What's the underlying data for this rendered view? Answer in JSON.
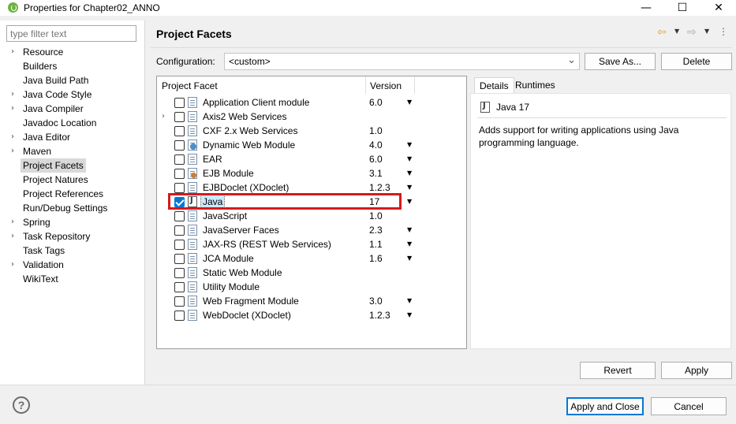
{
  "window": {
    "title": "Properties for Chapter02_ANNO",
    "minimize": "—",
    "maximize": "☐",
    "close": "✕"
  },
  "filter": {
    "placeholder": "type filter text"
  },
  "nav": {
    "items": [
      {
        "label": "Resource",
        "expandable": true
      },
      {
        "label": "Builders",
        "expandable": false
      },
      {
        "label": "Java Build Path",
        "expandable": false
      },
      {
        "label": "Java Code Style",
        "expandable": true
      },
      {
        "label": "Java Compiler",
        "expandable": true
      },
      {
        "label": "Javadoc Location",
        "expandable": false
      },
      {
        "label": "Java Editor",
        "expandable": true
      },
      {
        "label": "Maven",
        "expandable": true
      },
      {
        "label": "Project Facets",
        "expandable": false,
        "selected": true
      },
      {
        "label": "Project Natures",
        "expandable": false
      },
      {
        "label": "Project References",
        "expandable": false
      },
      {
        "label": "Run/Debug Settings",
        "expandable": false
      },
      {
        "label": "Spring",
        "expandable": true
      },
      {
        "label": "Task Repository",
        "expandable": true
      },
      {
        "label": "Task Tags",
        "expandable": false
      },
      {
        "label": "Validation",
        "expandable": true
      },
      {
        "label": "WikiText",
        "expandable": false
      }
    ]
  },
  "page": {
    "title": "Project Facets"
  },
  "config": {
    "label": "Configuration:",
    "value": "<custom>",
    "save_as": "Save As...",
    "delete": "Delete"
  },
  "facets": {
    "col_facet": "Project Facet",
    "col_version": "Version",
    "rows": [
      {
        "name": "Application Client module",
        "version": "6.0",
        "dropdown": true,
        "checked": false,
        "icon": "doc",
        "expandable": false
      },
      {
        "name": "Axis2 Web Services",
        "version": "",
        "dropdown": false,
        "checked": false,
        "icon": "doc",
        "expandable": true
      },
      {
        "name": "CXF 2.x Web Services",
        "version": "1.0",
        "dropdown": false,
        "checked": false,
        "icon": "doc",
        "expandable": false
      },
      {
        "name": "Dynamic Web Module",
        "version": "4.0",
        "dropdown": true,
        "checked": false,
        "icon": "globe",
        "expandable": false
      },
      {
        "name": "EAR",
        "version": "6.0",
        "dropdown": true,
        "checked": false,
        "icon": "doc",
        "expandable": false
      },
      {
        "name": "EJB Module",
        "version": "3.1",
        "dropdown": true,
        "checked": false,
        "icon": "gear",
        "expandable": false
      },
      {
        "name": "EJBDoclet (XDoclet)",
        "version": "1.2.3",
        "dropdown": true,
        "checked": false,
        "icon": "doc",
        "expandable": false
      },
      {
        "name": "Java",
        "version": "17",
        "dropdown": true,
        "checked": true,
        "icon": "java",
        "expandable": false,
        "selected": true
      },
      {
        "name": "JavaScript",
        "version": "1.0",
        "dropdown": false,
        "checked": false,
        "icon": "doc",
        "expandable": false
      },
      {
        "name": "JavaServer Faces",
        "version": "2.3",
        "dropdown": true,
        "checked": false,
        "icon": "doc",
        "expandable": false
      },
      {
        "name": "JAX-RS (REST Web Services)",
        "version": "1.1",
        "dropdown": true,
        "checked": false,
        "icon": "doc",
        "expandable": false
      },
      {
        "name": "JCA Module",
        "version": "1.6",
        "dropdown": true,
        "checked": false,
        "icon": "doc",
        "expandable": false
      },
      {
        "name": "Static Web Module",
        "version": "",
        "dropdown": false,
        "checked": false,
        "icon": "doc",
        "expandable": false
      },
      {
        "name": "Utility Module",
        "version": "",
        "dropdown": false,
        "checked": false,
        "icon": "doc",
        "expandable": false
      },
      {
        "name": "Web Fragment Module",
        "version": "3.0",
        "dropdown": true,
        "checked": false,
        "icon": "doc",
        "expandable": false
      },
      {
        "name": "WebDoclet (XDoclet)",
        "version": "1.2.3",
        "dropdown": true,
        "checked": false,
        "icon": "doc",
        "expandable": false
      }
    ]
  },
  "details": {
    "tab_details": "Details",
    "tab_runtimes": "Runtimes",
    "title": "Java 17",
    "description": "Adds support for writing applications using Java programming language."
  },
  "buttons": {
    "revert": "Revert",
    "apply": "Apply",
    "apply_close": "Apply and Close",
    "cancel": "Cancel"
  },
  "help": {
    "glyph": "?"
  },
  "colors": {
    "highlight": "#d7191c",
    "accent": "#0078d7"
  }
}
